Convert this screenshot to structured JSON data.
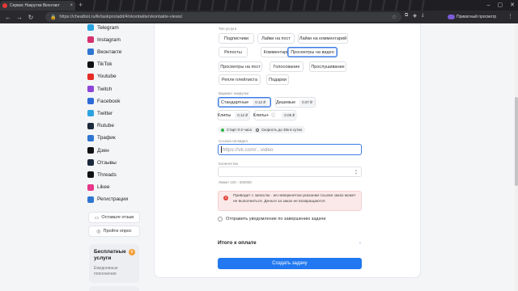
{
  "browser": {
    "tab_title": "Сервис Накрутки Вконтакт",
    "tab_close": "×",
    "new_tab": "+",
    "url": "https://cheatbot.ru/lk/taskpro/add/4/vkontakte/vkontakte-views/",
    "private_label": "Приватный просмотр",
    "window_controls": [
      "–",
      "▢",
      "✕"
    ]
  },
  "sidebar": {
    "items": [
      {
        "label": "Telegram",
        "color": "#2aa3df",
        "icon": "telegram-icon"
      },
      {
        "label": "Instagram",
        "color": "#d6306e",
        "icon": "instagram-icon"
      },
      {
        "label": "Вконтакте",
        "color": "#2f76d2",
        "icon": "vk-icon"
      },
      {
        "label": "TikTok",
        "color": "#111111",
        "icon": "tiktok-icon"
      },
      {
        "label": "Youtube",
        "color": "#e52d27",
        "icon": "youtube-icon"
      },
      {
        "label": "Twitch",
        "color": "#8e44d8",
        "icon": "twitch-icon"
      },
      {
        "label": "Facebook",
        "color": "#2d6cd6",
        "icon": "facebook-icon"
      },
      {
        "label": "Twitter",
        "color": "#2aa3df",
        "icon": "twitter-icon"
      },
      {
        "label": "Rutube",
        "color": "#1b2a3c",
        "icon": "rutube-icon"
      },
      {
        "label": "Трафик",
        "color": "#2f76d2",
        "icon": "traffic-icon"
      },
      {
        "label": "Дзен",
        "color": "#111111",
        "icon": "dzen-icon"
      },
      {
        "label": "Отзывы",
        "color": "#1b2a3c",
        "icon": "reviews-icon"
      },
      {
        "label": "Threads",
        "color": "#111111",
        "icon": "threads-icon"
      },
      {
        "label": "Likee",
        "color": "#e6378a",
        "icon": "likee-icon"
      },
      {
        "label": "Регистрации",
        "color": "#2f76d2",
        "icon": "registration-icon"
      }
    ],
    "leave_review": "Оставьте отзыв",
    "take_survey": "Пройти опрос",
    "promo_title": "Бесплатные услуги",
    "promo_sub": "Ежедневные пополнения",
    "promo_badge": "₽"
  },
  "form": {
    "task_type_label": "Тип услуги",
    "task_types": [
      "Подписчики",
      "Лайки на пост",
      "Лайки на комментарий",
      "Репосты",
      "Комментарии",
      "Просмотры на видео",
      "Просмотры на пост",
      "Голосование",
      "Прослушивание",
      "Репле плейлиста",
      "Подарки"
    ],
    "selected_task_type": "Просмотры на видео",
    "variant_label": "Вариант накрутки",
    "variants": [
      {
        "label": "Стандартные",
        "price": "0.12 ₽",
        "selected": true
      },
      {
        "label": "Дешевые",
        "price": "0.07 ₽",
        "selected": false
      },
      {
        "label": "Клипы",
        "price": "0.12 ₽",
        "selected": false
      },
      {
        "label": "Клипы+",
        "price": "0.09 ₽",
        "selected": false
      }
    ],
    "start_badge": "Старт 0-2 часа",
    "speed_badge": "Скорость до 30к в сутки",
    "link_label": "Ссылка на видео",
    "link_placeholder": "https://vk.com/...video",
    "quantity_label": "Количество",
    "quantity_hint": "Лимит 100 - 500000",
    "alert_text": "Приводит с запаслю . ая неверкнетом указании ссылки заказ может не выполниться. Деньги за заказ не возвращаются",
    "notify_label": "Отправить уведомление по завершению задачи",
    "total_label": "Итого к оплате",
    "submit_label": "Создать задачу"
  }
}
